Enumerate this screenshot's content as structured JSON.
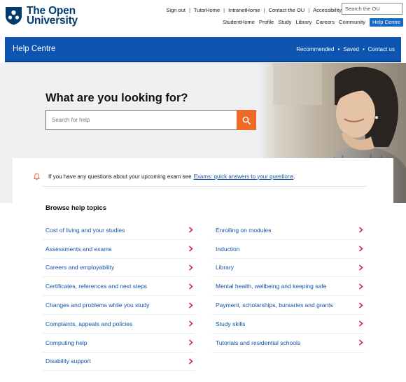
{
  "logo": {
    "line1": "The Open",
    "line2": "University"
  },
  "utility_nav": [
    "Sign out",
    "TutorHome",
    "IntranetHome",
    "Contact the OU",
    "Accessibility"
  ],
  "site_search": {
    "placeholder": "Search the OU"
  },
  "main_nav": [
    "StudentHome",
    "Profile",
    "Study",
    "Library",
    "Careers",
    "Community",
    "Help Centre"
  ],
  "help_bar": {
    "title": "Help Centre",
    "links": [
      "Recommended",
      "Saved",
      "Contact us"
    ]
  },
  "hero": {
    "heading": "What are you looking for?",
    "search_placeholder": "Search for help"
  },
  "notice": {
    "text": "If you have any questions about your upcoming exam see",
    "link": "Exams: quick answers to your questions",
    "end": "."
  },
  "browse": {
    "title": "Browse help topics",
    "left": [
      "Cost of living and your studies",
      "Assessments and exams",
      "Careers and employability",
      "Certificates, references and next steps",
      "Changes and problems while you study",
      "Complaints, appeals and policies",
      "Computing help",
      "Disability support"
    ],
    "right": [
      "Enrolling on modules",
      "Induction",
      "Library",
      "Mental health, wellbeing and keeping safe",
      "Payment, scholarships, bursaries and grants",
      "Study skills",
      "Tutorials and residential schools"
    ]
  },
  "colors": {
    "brand_blue": "#0d55b1",
    "logo_navy": "#003b6f",
    "link_blue": "#1254a6",
    "search_orange": "#ed6a27",
    "chevron": "#d1195e"
  },
  "icons": {
    "notice": "bell-icon",
    "search": "magnifier-icon",
    "topic": "chevron-right-icon"
  }
}
